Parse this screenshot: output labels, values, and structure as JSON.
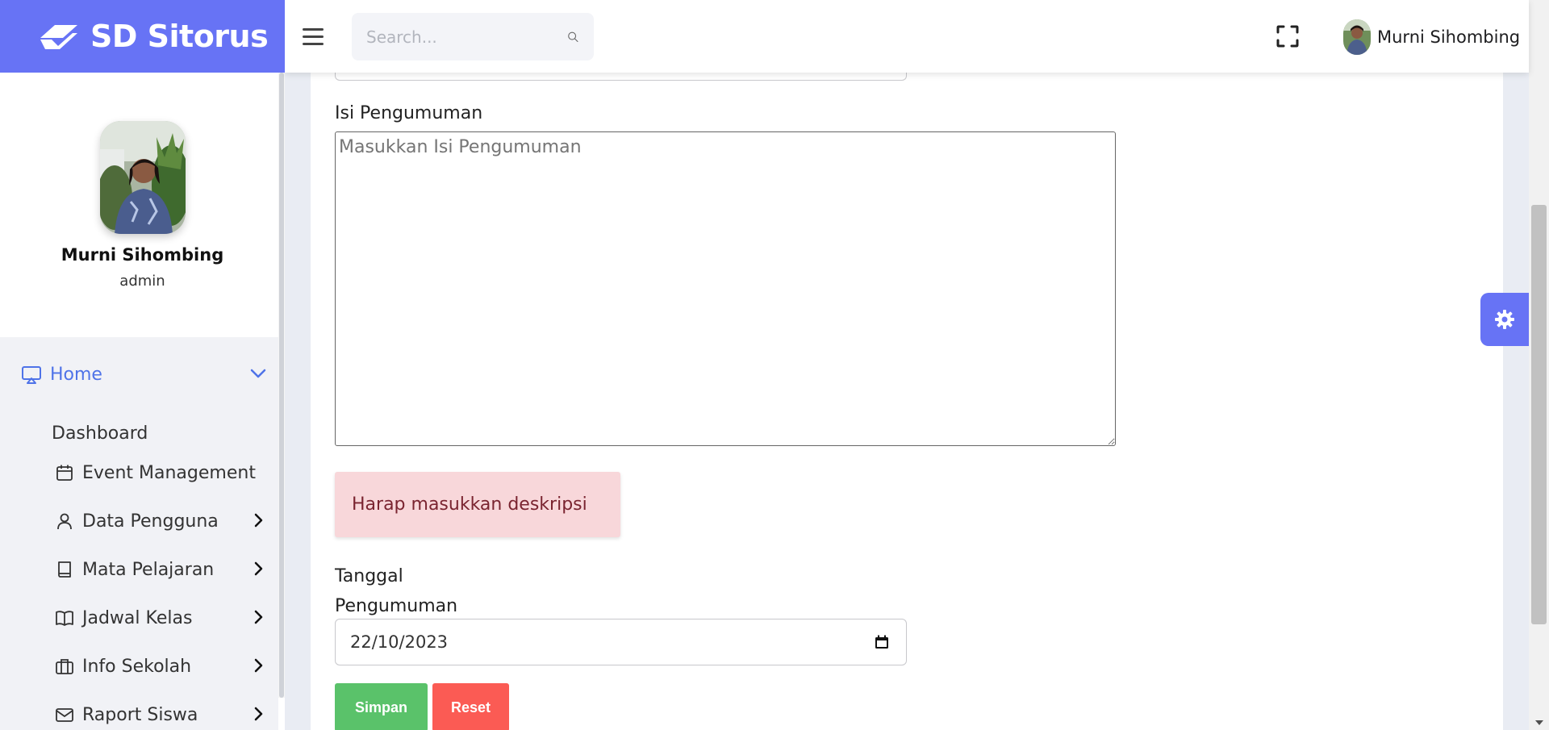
{
  "brand": {
    "name": "SD Sitorus"
  },
  "header": {
    "search_placeholder": "Search...",
    "user_name": "Murni Sihombing"
  },
  "profile": {
    "name": "Murni Sihombing",
    "role": "admin"
  },
  "sidebar": {
    "home_label": "Home",
    "dashboard_label": "Dashboard",
    "items": [
      {
        "label": "Event Management",
        "icon": "calendar-icon",
        "has_submenu": false
      },
      {
        "label": "Data Pengguna",
        "icon": "user-icon",
        "has_submenu": true
      },
      {
        "label": "Mata Pelajaran",
        "icon": "book-icon",
        "has_submenu": true
      },
      {
        "label": "Jadwal Kelas",
        "icon": "open-book-icon",
        "has_submenu": true
      },
      {
        "label": "Info Sekolah",
        "icon": "briefcase-icon",
        "has_submenu": true
      },
      {
        "label": "Raport Siswa",
        "icon": "mail-icon",
        "has_submenu": true
      }
    ]
  },
  "form": {
    "isi_label": "Isi Pengumuman",
    "isi_placeholder": "Masukkan Isi Pengumuman",
    "isi_value": "",
    "alert_text": "Harap masukkan deskripsi",
    "tanggal_label_line1": "Tanggal",
    "tanggal_label_line2": "Pengumuman",
    "tanggal_value": "22/10/2023",
    "save_label": "Simpan",
    "reset_label": "Reset"
  },
  "colors": {
    "brand": "#6773f5",
    "home_active": "#4f73e8",
    "save": "#5ac26a",
    "reset": "#fb5b54",
    "alert_bg": "#f8d7da"
  }
}
